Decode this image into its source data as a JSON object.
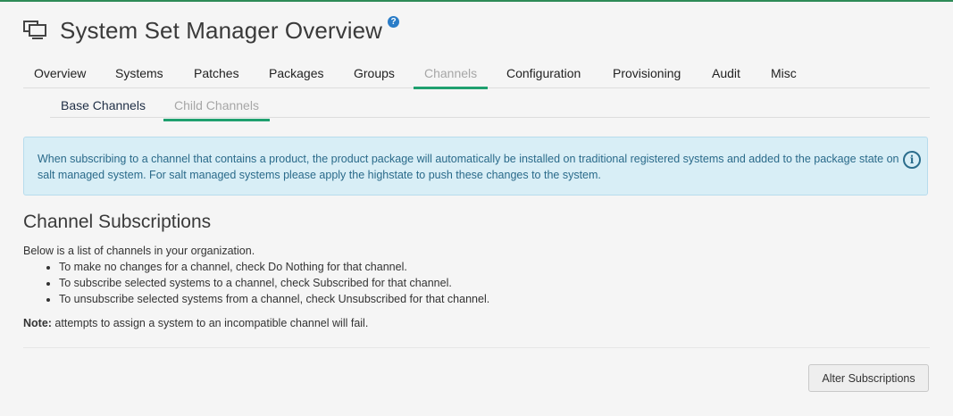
{
  "header": {
    "title": "System Set Manager Overview",
    "icon": "system-set-icon",
    "help_icon": "question-circle-icon"
  },
  "tabs": [
    {
      "label": "Overview",
      "active": false
    },
    {
      "label": "Systems",
      "active": false
    },
    {
      "label": "Patches",
      "active": false
    },
    {
      "label": "Packages",
      "active": false
    },
    {
      "label": "Groups",
      "active": false
    },
    {
      "label": "Channels",
      "active": true
    },
    {
      "label": "Configuration",
      "active": false
    },
    {
      "label": "Provisioning",
      "active": false
    },
    {
      "label": "Audit",
      "active": false
    },
    {
      "label": "Misc",
      "active": false
    }
  ],
  "subtabs": [
    {
      "label": "Base Channels",
      "active": false
    },
    {
      "label": "Child Channels",
      "active": true
    }
  ],
  "alert": {
    "text": "When subscribing to a channel that contains a product, the product package will automatically be installed on traditional registered systems and added to the package state on salt managed system. For salt managed systems please apply the highstate to push these changes to the system.",
    "icon": "info-circle-icon"
  },
  "section": {
    "title": "Channel Subscriptions",
    "intro": "Below is a list of channels in your organization.",
    "bullets": [
      "To make no changes for a channel, check Do Nothing for that channel.",
      "To subscribe selected systems to a channel, check Subscribed for that channel.",
      "To unsubscribe selected systems from a channel, check Unsubscribed for that channel."
    ],
    "note_label": "Note:",
    "note_text": " attempts to assign a system to an incompatible channel will fail."
  },
  "actions": {
    "alter_label": "Alter Subscriptions"
  },
  "colors": {
    "accent_green": "#1fa06f",
    "alert_bg": "#d8eef6",
    "alert_text": "#2a6a8a"
  }
}
